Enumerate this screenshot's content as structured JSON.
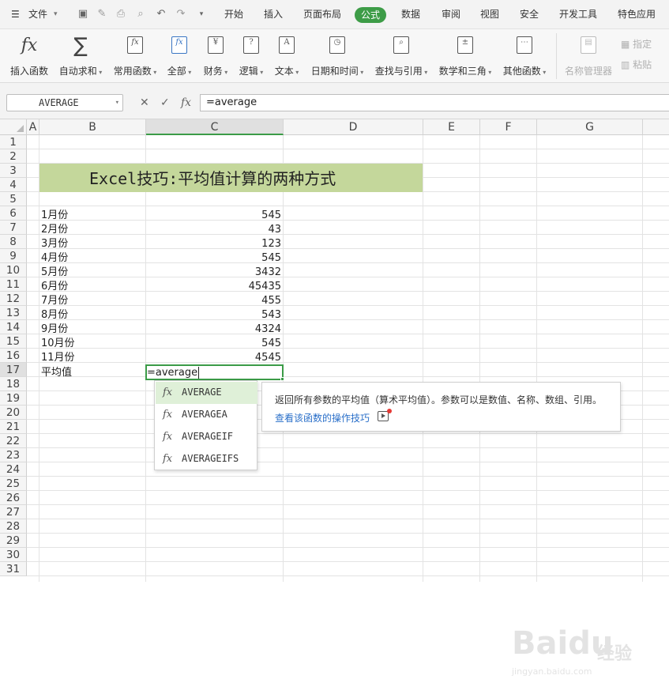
{
  "menubar": {
    "file_label": "文件",
    "tabs": [
      "开始",
      "插入",
      "页面布局",
      "公式",
      "数据",
      "审阅",
      "视图",
      "安全",
      "开发工具",
      "特色应用"
    ],
    "active_tab": "公式"
  },
  "ribbon": {
    "buttons": [
      {
        "label": "插入函数",
        "icon": "fx-icon"
      },
      {
        "label": "自动求和",
        "icon": "sigma-icon"
      },
      {
        "label": "常用函数",
        "icon": "common-functions-icon"
      },
      {
        "label": "全部",
        "icon": "all-functions-icon"
      },
      {
        "label": "财务",
        "icon": "finance-icon"
      },
      {
        "label": "逻辑",
        "icon": "logic-icon"
      },
      {
        "label": "文本",
        "icon": "text-icon"
      },
      {
        "label": "日期和时间",
        "icon": "clock-icon"
      },
      {
        "label": "查找与引用",
        "icon": "lookup-icon"
      },
      {
        "label": "数学和三角",
        "icon": "math-icon"
      },
      {
        "label": "其他函数",
        "icon": "more-functions-icon"
      },
      {
        "label": "名称管理器",
        "icon": "name-manager-icon"
      }
    ],
    "side": [
      "指定",
      "粘贴"
    ]
  },
  "formula_bar": {
    "name_box": "AVERAGE",
    "fx_label": "fx",
    "value": "=average"
  },
  "grid": {
    "columns": [
      "A",
      "B",
      "C",
      "D",
      "E",
      "F",
      "G"
    ],
    "rows": [
      "1",
      "2",
      "3",
      "4",
      "5",
      "6",
      "7",
      "8",
      "9",
      "10",
      "11",
      "12",
      "13",
      "14",
      "15",
      "16",
      "17",
      "18",
      "19",
      "20",
      "21",
      "22",
      "23",
      "24",
      "25",
      "26",
      "27",
      "28",
      "29",
      "30",
      "31"
    ],
    "title": "Excel技巧:平均值计算的两种方式",
    "data": [
      {
        "month": "1月份",
        "value": "545"
      },
      {
        "month": "2月份",
        "value": "43"
      },
      {
        "month": "3月份",
        "value": "123"
      },
      {
        "month": "4月份",
        "value": "545"
      },
      {
        "month": "5月份",
        "value": "3432"
      },
      {
        "month": "6月份",
        "value": "45435"
      },
      {
        "month": "7月份",
        "value": "455"
      },
      {
        "month": "8月份",
        "value": "543"
      },
      {
        "month": "9月份",
        "value": "4324"
      },
      {
        "month": "10月份",
        "value": "545"
      },
      {
        "month": "11月份",
        "value": "4545"
      }
    ],
    "avg_label": "平均值",
    "edit_value": "=average"
  },
  "autocomplete": {
    "items": [
      "AVERAGE",
      "AVERAGEA",
      "AVERAGEIF",
      "AVERAGEIFS"
    ],
    "fx": "fx",
    "selected": "AVERAGE"
  },
  "tooltip": {
    "description": "返回所有参数的平均值（算术平均值）。参数可以是数值、名称、数组、引用。",
    "link": "查看该函数的操作技巧"
  },
  "watermark": {
    "text": "Baidu",
    "jingyan": "经验",
    "url": "jingyan.baidu.com"
  }
}
